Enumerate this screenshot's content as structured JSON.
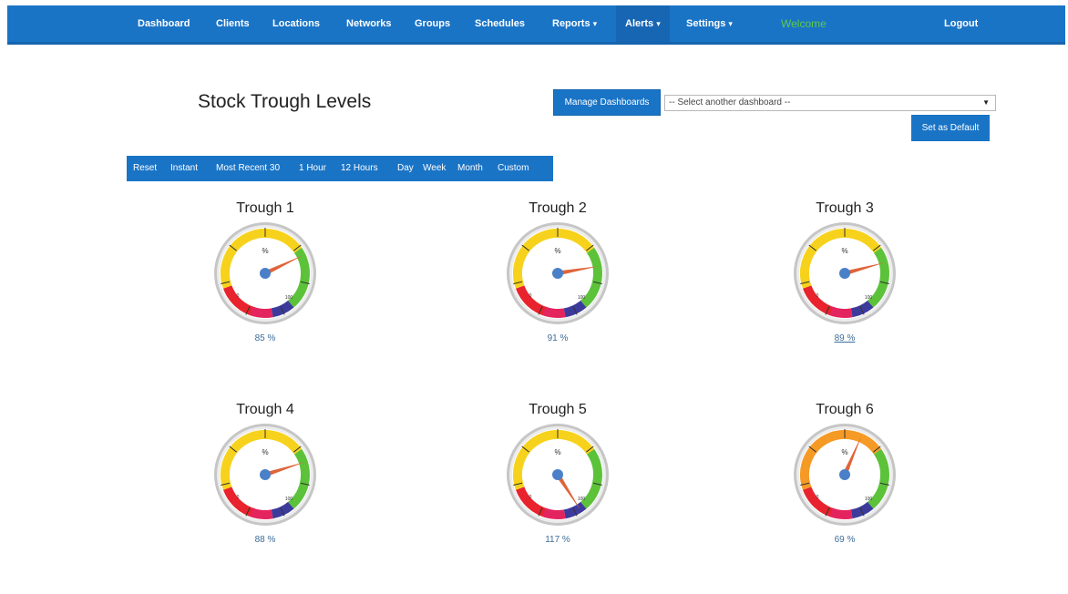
{
  "nav": {
    "items": [
      {
        "label": "Dashboard"
      },
      {
        "label": "Clients"
      },
      {
        "label": "Locations"
      },
      {
        "label": "Networks"
      },
      {
        "label": "Groups"
      },
      {
        "label": "Schedules"
      },
      {
        "label": "Reports",
        "caret": "▾"
      },
      {
        "label": "Alerts",
        "caret": "▾"
      },
      {
        "label": "Settings",
        "caret": "▾"
      }
    ],
    "welcome": "Welcome",
    "logout": "Logout"
  },
  "header": {
    "title": "Stock Trough Levels",
    "manage_label": "Manage Dashboards",
    "select_value": "-- Select another dashboard --",
    "select_arrow": "▼",
    "default_label": "Set as Default"
  },
  "range": {
    "items": [
      "Reset",
      "Instant",
      "Most Recent 30",
      "1 Hour",
      "12 Hours",
      "Day",
      "Week",
      "Month",
      "Custom"
    ]
  },
  "gauges": [
    {
      "title": "Trough 1",
      "value": 85,
      "value_text": "85 %",
      "unit": "%",
      "min_label": "0",
      "max_label": "100",
      "top_color": "#f7d21c"
    },
    {
      "title": "Trough 2",
      "value": 91,
      "value_text": "91 %",
      "unit": "%",
      "min_label": "0",
      "max_label": "100",
      "top_color": "#f7d21c"
    },
    {
      "title": "Trough 3",
      "value": 89,
      "value_text": "89 %",
      "unit": "%",
      "min_label": "0",
      "max_label": "100",
      "top_color": "#f7d21c"
    },
    {
      "title": "Trough 4",
      "value": 88,
      "value_text": "88 %",
      "unit": "%",
      "min_label": "0",
      "max_label": "100",
      "top_color": "#f7d21c"
    },
    {
      "title": "Trough 5",
      "value": 117,
      "value_text": "117 %",
      "unit": "%",
      "min_label": "0",
      "max_label": "100",
      "top_color": "#f7d21c"
    },
    {
      "title": "Trough 6",
      "value": 69,
      "value_text": "69 %",
      "unit": "%",
      "min_label": "0",
      "max_label": "100",
      "top_color": "#f59a25"
    }
  ],
  "colors": {
    "brand": "#1a74c6",
    "welcome": "#5ec94b",
    "band_red": "#e8232e",
    "band_green": "#5cc23a",
    "band_navy": "#3c3b9c",
    "band_pink": "#e4245e",
    "needle": "#e0643a",
    "hub": "#4a80c8"
  }
}
